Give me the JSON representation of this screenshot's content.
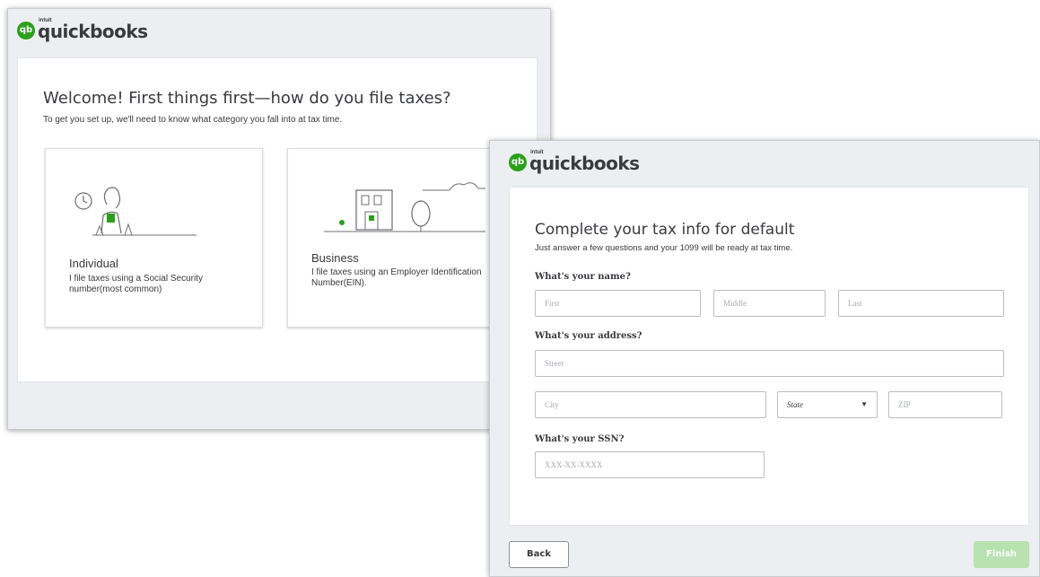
{
  "brand": {
    "intuit": "intuit",
    "name": "quickbooks",
    "mark": "qb",
    "color": "#2ca01c"
  },
  "welcome": {
    "title": "Welcome! First things first—how do you file taxes?",
    "subtitle": "To get you set up, we'll need to know what category you fall into at tax time.",
    "options": [
      {
        "title": "Individual",
        "desc": "I file taxes using a Social Security number(most common)"
      },
      {
        "title": "Business",
        "desc": "I file taxes using an Employer Identification Number(EIN)."
      }
    ]
  },
  "taxinfo": {
    "title": "Complete your tax info for default",
    "subtitle": "Just answer a few questions and your 1099 will be ready at tax time.",
    "name_label": "What's your name?",
    "first_ph": "First",
    "middle_ph": "Middle",
    "last_ph": "Last",
    "address_label": "What's your address?",
    "street_ph": "Street",
    "city_ph": "City",
    "state_value": "State",
    "zip_ph": "ZIP",
    "ssn_label": "What's your SSN?",
    "ssn_ph": "XXX-XX-XXXX",
    "back_label": "Back",
    "finish_label": "Finish"
  }
}
